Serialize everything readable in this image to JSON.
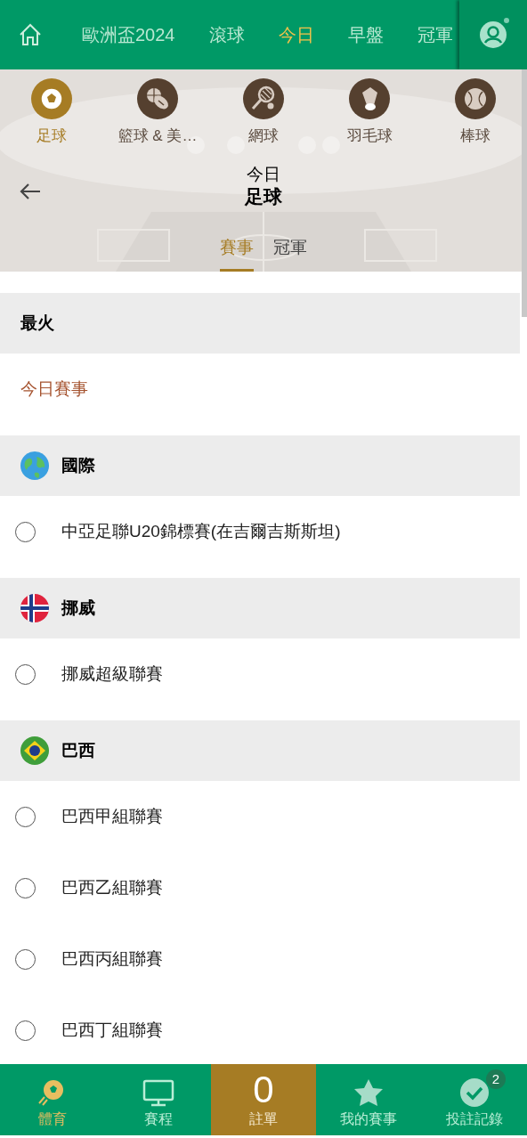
{
  "top_nav": {
    "items": [
      {
        "label": "歐洲盃2024",
        "selected": false
      },
      {
        "label": "滾球",
        "selected": false
      },
      {
        "label": "今日",
        "selected": true
      },
      {
        "label": "早盤",
        "selected": false
      },
      {
        "label": "冠軍",
        "selected": false
      }
    ]
  },
  "sports": [
    {
      "kind": "soccer",
      "label": "足球",
      "selected": true
    },
    {
      "kind": "basketball",
      "label": "籃球 & 美…",
      "selected": false
    },
    {
      "kind": "tennis",
      "label": "網球",
      "selected": false
    },
    {
      "kind": "badminton",
      "label": "羽毛球",
      "selected": false
    },
    {
      "kind": "baseball",
      "label": "棒球",
      "selected": false
    }
  ],
  "header": {
    "subtitle": "今日",
    "title": "足球"
  },
  "tabs": [
    {
      "label": "賽事",
      "selected": true
    },
    {
      "label": "冠軍",
      "selected": false
    }
  ],
  "sections": [
    {
      "kind": "plain",
      "title": "最火",
      "items": [
        {
          "kind": "link",
          "label": "今日賽事"
        }
      ]
    },
    {
      "kind": "globe",
      "title": "國際",
      "items": [
        {
          "kind": "radio",
          "label": "中亞足聯U20錦標賽(在吉爾吉斯斯坦)",
          "checked": false
        }
      ]
    },
    {
      "kind": "norway",
      "title": "挪威",
      "items": [
        {
          "kind": "radio",
          "label": "挪威超級聯賽",
          "checked": false
        }
      ]
    },
    {
      "kind": "brazil",
      "title": "巴西",
      "items": [
        {
          "kind": "radio",
          "label": "巴西甲組聯賽",
          "checked": false
        },
        {
          "kind": "radio",
          "label": "巴西乙組聯賽",
          "checked": false
        },
        {
          "kind": "radio",
          "label": "巴西丙組聯賽",
          "checked": false
        },
        {
          "kind": "radio",
          "label": "巴西丁組聯賽",
          "checked": false
        }
      ]
    }
  ],
  "bottom_nav": [
    {
      "kind": "sports",
      "label": "體育",
      "selected": true
    },
    {
      "kind": "schedule",
      "label": "賽程",
      "selected": false
    },
    {
      "kind": "betslip",
      "label": "註單",
      "count": "0"
    },
    {
      "kind": "favorites",
      "label": "我的賽事",
      "selected": false
    },
    {
      "kind": "history",
      "label": "投註記錄",
      "badge": "2",
      "selected": false
    }
  ]
}
